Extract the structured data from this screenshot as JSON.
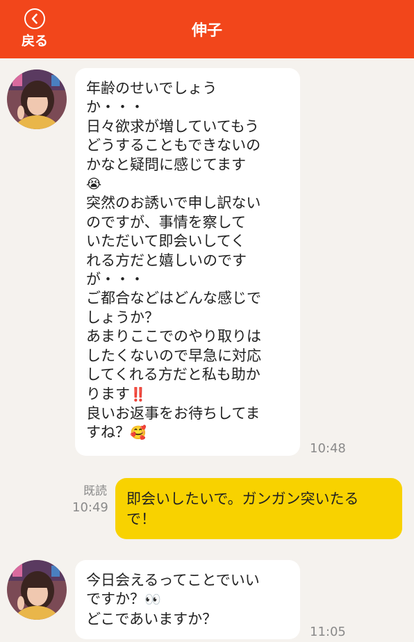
{
  "header": {
    "back_label": "戻る",
    "title": "伸子"
  },
  "messages": [
    {
      "sender": "伸子",
      "text_1": "年齢のせいでしょう\nか・・・\n日々欲求が増していてもう\nどうすることもできないの\nかなと疑問に感じてます\n",
      "emoji_1": "😭",
      "text_2": "\n突然のお誘いで申し訳ない\nのですが、事情を察して\nいただいて即会いしてく\nれる方だと嬉しいのです\nが・・・\nご都合などはどんな感じで\nしょうか？\nあまりここでのやり取りは\nしたくないので早急に対応\nしてくれる方だと私も助か\nります",
      "emoji_2": "‼️",
      "text_3": "\n良いお返事をお待ちしてま\nすね？",
      "emoji_3": "🥰",
      "time": "10:48"
    },
    {
      "sender": "me",
      "read_label": "既読",
      "time": "10:49",
      "text": "即会いしたいで。ガンガン突いたる\nで！"
    },
    {
      "sender": "伸子",
      "text_1": "今日会えるってことでいい\nですか？",
      "emoji_1": "👀",
      "text_2": "\nどこであいますか？",
      "time": "11:05"
    }
  ],
  "colors": {
    "header_bg": "#f2461b",
    "page_bg": "#f5f2ee",
    "outgoing_bubble": "#f8d200",
    "incoming_bubble": "#ffffff"
  }
}
